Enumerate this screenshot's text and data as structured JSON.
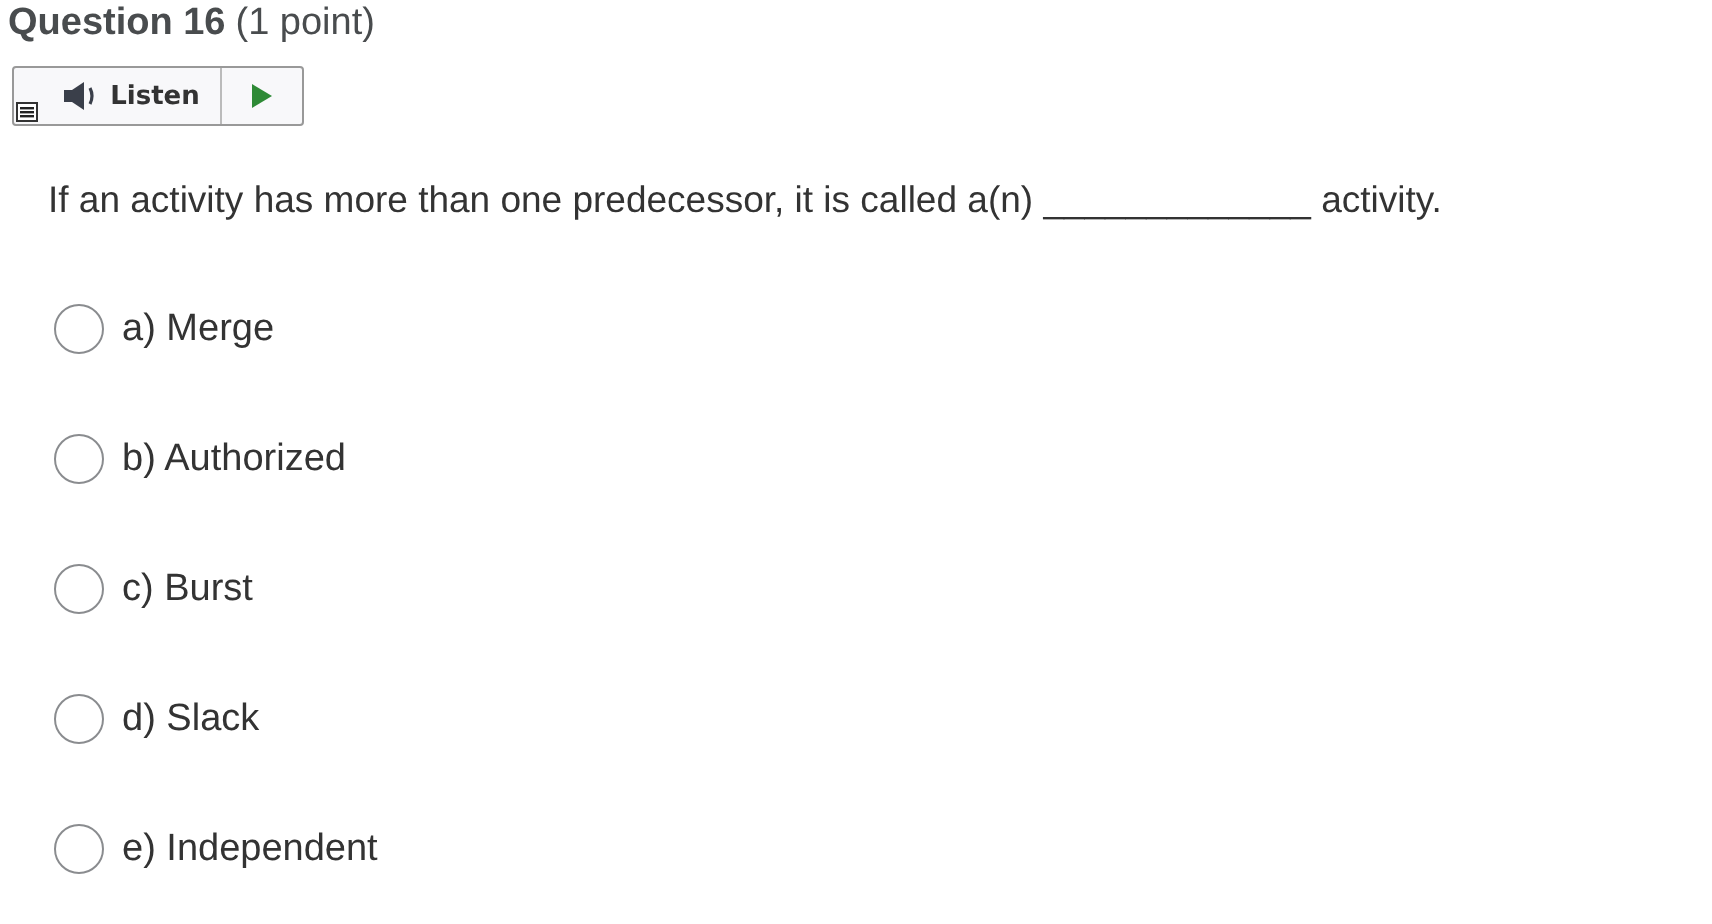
{
  "question": {
    "title": "Question 16",
    "points": "(1 point)"
  },
  "listen": {
    "label": "Listen"
  },
  "prompt": "If an activity has more than one predecessor, it is called a(n) _____________ activity.",
  "options": [
    {
      "label": "a) Merge",
      "selected": false
    },
    {
      "label": "b) Authorized",
      "selected": false
    },
    {
      "label": "c) Burst",
      "selected": false
    },
    {
      "label": "d) Slack",
      "selected": false
    },
    {
      "label": "e) Independent",
      "selected": false
    }
  ]
}
